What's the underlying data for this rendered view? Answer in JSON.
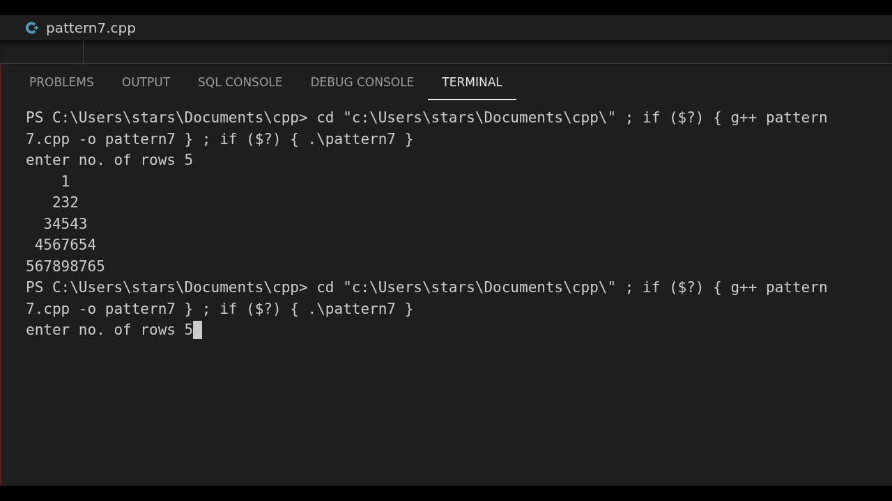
{
  "editor_tab": {
    "title": "pattern7.cpp"
  },
  "panel_tabs": [
    {
      "label": "PROBLEMS",
      "selected": false
    },
    {
      "label": "OUTPUT",
      "selected": false
    },
    {
      "label": "SQL CONSOLE",
      "selected": false
    },
    {
      "label": "DEBUG CONSOLE",
      "selected": false
    },
    {
      "label": "TERMINAL",
      "selected": true
    }
  ],
  "terminal": {
    "lines": [
      "PS C:\\Users\\stars\\Documents\\cpp> cd \"c:\\Users\\stars\\Documents\\cpp\\\" ; if ($?) { g++ pattern",
      "7.cpp -o pattern7 } ; if ($?) { .\\pattern7 }",
      "enter no. of rows 5",
      "    1",
      "   232",
      "  34543",
      " 4567654",
      "567898765",
      "PS C:\\Users\\stars\\Documents\\cpp> cd \"c:\\Users\\stars\\Documents\\cpp\\\" ; if ($?) { g++ pattern",
      "7.cpp -o pattern7 } ; if ($?) { .\\pattern7 }",
      "enter no. of rows 5"
    ],
    "cursor": true
  }
}
